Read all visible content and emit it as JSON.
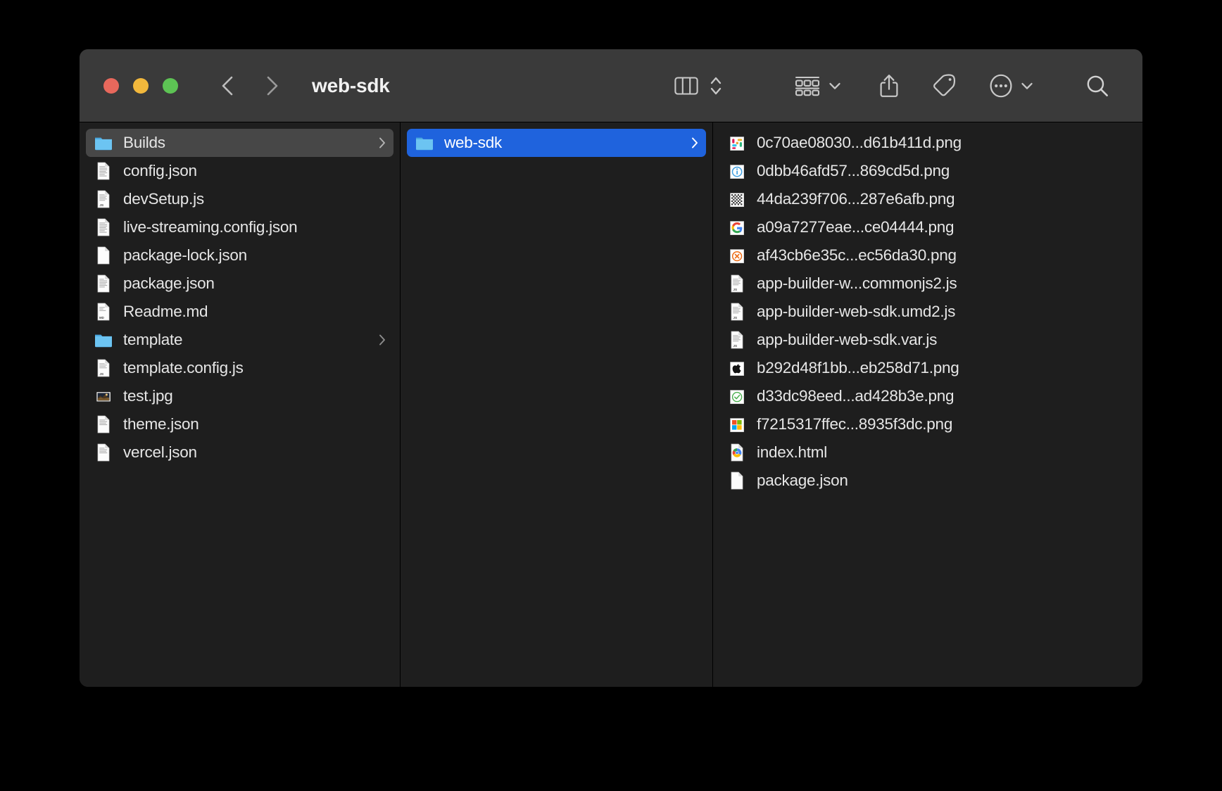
{
  "window": {
    "title": "web-sdk",
    "traffic_lights": [
      {
        "name": "close",
        "color": "#e8685c"
      },
      {
        "name": "minimize",
        "color": "#f2b83c"
      },
      {
        "name": "maximize",
        "color": "#5dc354"
      }
    ]
  },
  "toolbar": {
    "back_label": "Back",
    "forward_label": "Forward",
    "items": [
      {
        "icon": "column-view-icon",
        "label": "Column View"
      },
      {
        "icon": "sort-arrows-icon",
        "label": "Sort Order"
      },
      {
        "icon": "group-grid-icon",
        "label": "Group Items",
        "caret": true
      },
      {
        "icon": "share-icon",
        "label": "Share"
      },
      {
        "icon": "tag-icon",
        "label": "Tags"
      },
      {
        "icon": "more-ellipsis-icon",
        "label": "More Options",
        "caret": true
      },
      {
        "icon": "search-icon",
        "label": "Search"
      }
    ]
  },
  "columns": [
    {
      "name": "column-one",
      "items": [
        {
          "label": "Builds",
          "icon": "folder-icon",
          "selected": "gray",
          "chevron": true
        },
        {
          "label": "config.json",
          "icon": "doc-text-icon",
          "selected": null,
          "chevron": false
        },
        {
          "label": "devSetup.js",
          "icon": "doc-js-icon",
          "selected": null,
          "chevron": false
        },
        {
          "label": "live-streaming.config.json",
          "icon": "doc-text-icon",
          "selected": null,
          "chevron": false
        },
        {
          "label": "package-lock.json",
          "icon": "doc-blank-icon",
          "selected": null,
          "chevron": false
        },
        {
          "label": "package.json",
          "icon": "doc-text-icon",
          "selected": null,
          "chevron": false
        },
        {
          "label": "Readme.md",
          "icon": "doc-md-icon",
          "selected": null,
          "chevron": false
        },
        {
          "label": "template",
          "icon": "folder-icon",
          "selected": null,
          "chevron": true
        },
        {
          "label": "template.config.js",
          "icon": "doc-js-icon",
          "selected": null,
          "chevron": false
        },
        {
          "label": "test.jpg",
          "icon": "photo-thumb-icon",
          "selected": null,
          "chevron": false
        },
        {
          "label": "theme.json",
          "icon": "doc-text-icon",
          "selected": null,
          "chevron": false
        },
        {
          "label": "vercel.json",
          "icon": "doc-text-icon",
          "selected": null,
          "chevron": false
        }
      ]
    },
    {
      "name": "column-two",
      "items": [
        {
          "label": "web-sdk",
          "icon": "folder-icon",
          "selected": "blue",
          "chevron": true
        }
      ]
    },
    {
      "name": "column-three",
      "items": [
        {
          "label": "0c70ae08030...d61b411d.png",
          "icon": "slack-png-icon",
          "selected": null,
          "chevron": false
        },
        {
          "label": "0dbb46afd57...869cd5d.png",
          "icon": "info-png-icon",
          "selected": null,
          "chevron": false
        },
        {
          "label": "44da239f706...287e6afb.png",
          "icon": "checker-png-icon",
          "selected": null,
          "chevron": false
        },
        {
          "label": "a09a7277eae...ce04444.png",
          "icon": "google-png-icon",
          "selected": null,
          "chevron": false
        },
        {
          "label": "af43cb6e35c...ec56da30.png",
          "icon": "error-x-png-icon",
          "selected": null,
          "chevron": false
        },
        {
          "label": "app-builder-w...commonjs2.js",
          "icon": "doc-js-icon",
          "selected": null,
          "chevron": false
        },
        {
          "label": "app-builder-web-sdk.umd2.js",
          "icon": "doc-js-icon",
          "selected": null,
          "chevron": false
        },
        {
          "label": "app-builder-web-sdk.var.js",
          "icon": "doc-js-icon",
          "selected": null,
          "chevron": false
        },
        {
          "label": "b292d48f1bb...eb258d71.png",
          "icon": "apple-png-icon",
          "selected": null,
          "chevron": false
        },
        {
          "label": "d33dc98eed...ad428b3e.png",
          "icon": "check-green-png-icon",
          "selected": null,
          "chevron": false
        },
        {
          "label": "f7215317ffec...8935f3dc.png",
          "icon": "microsoft-png-icon",
          "selected": null,
          "chevron": false
        },
        {
          "label": "index.html",
          "icon": "chrome-html-icon",
          "selected": null,
          "chevron": false
        },
        {
          "label": "package.json",
          "icon": "doc-blank-icon",
          "selected": null,
          "chevron": false
        }
      ]
    }
  ],
  "colors": {
    "window_bg": "#1e1e1e",
    "titlebar_bg": "#3a3a3a",
    "selection_blue": "#1f63dd",
    "selection_gray": "#474747",
    "text": "#e6e6e6",
    "folder_blue": "#54b6ef"
  }
}
